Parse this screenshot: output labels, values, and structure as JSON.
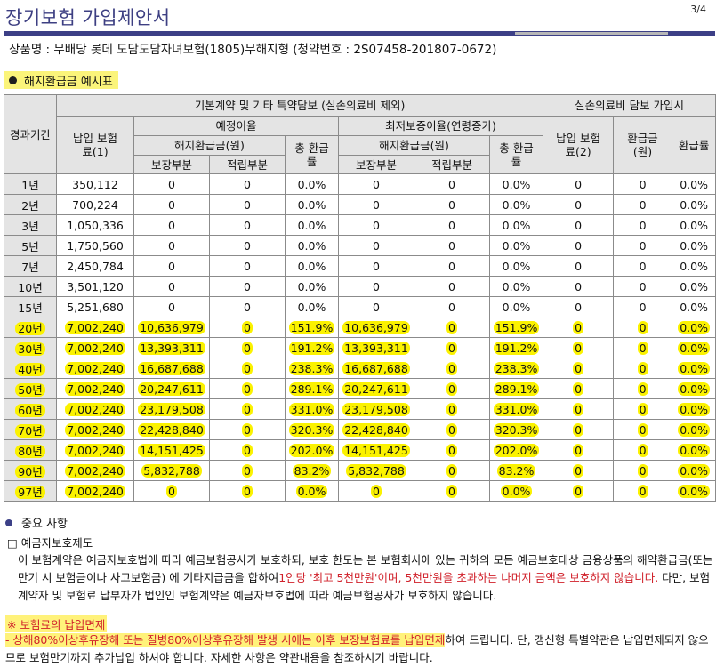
{
  "header": {
    "title": "장기보험 가입제안서",
    "page": "3/4"
  },
  "product": "상품명 : 무배당 롯데 도담도담자녀보험(1805)무해지형 (청약번호 : 2S07458-201807-0672)",
  "section_title": "해지환급금 예시표",
  "table": {
    "h_period": "경과기간",
    "h_basic": "기본계약 및 기타 특약담보 (실손의료비 제외)",
    "h_medical": "실손의료비 담보 가입시",
    "h_premium1": "납입 보험료(1)",
    "h_expected": "예정이율",
    "h_min": "최저보증이율(연령증가)",
    "h_surrender_a": "해지환급금(원)",
    "h_surrender_b": "해지환급금(원)",
    "h_total_a": "총 환급률",
    "h_total_b": "총 환급률",
    "h_protect_a": "보장부분",
    "h_save_a": "적립부분",
    "h_protect_b": "보장부분",
    "h_save_b": "적립부분",
    "h_premium2": "납입 보험료(2)",
    "h_refund": "환급금 (원)",
    "h_rate": "환급률",
    "rows": [
      [
        "1년",
        "350,112",
        "0",
        "0",
        "0.0%",
        "0",
        "0",
        "0.0%",
        "0",
        "0",
        "0.0%"
      ],
      [
        "2년",
        "700,224",
        "0",
        "0",
        "0.0%",
        "0",
        "0",
        "0.0%",
        "0",
        "0",
        "0.0%"
      ],
      [
        "3년",
        "1,050,336",
        "0",
        "0",
        "0.0%",
        "0",
        "0",
        "0.0%",
        "0",
        "0",
        "0.0%"
      ],
      [
        "5년",
        "1,750,560",
        "0",
        "0",
        "0.0%",
        "0",
        "0",
        "0.0%",
        "0",
        "0",
        "0.0%"
      ],
      [
        "7년",
        "2,450,784",
        "0",
        "0",
        "0.0%",
        "0",
        "0",
        "0.0%",
        "0",
        "0",
        "0.0%"
      ],
      [
        "10년",
        "3,501,120",
        "0",
        "0",
        "0.0%",
        "0",
        "0",
        "0.0%",
        "0",
        "0",
        "0.0%"
      ],
      [
        "15년",
        "5,251,680",
        "0",
        "0",
        "0.0%",
        "0",
        "0",
        "0.0%",
        "0",
        "0",
        "0.0%"
      ],
      [
        "20년",
        "7,002,240",
        "10,636,979",
        "0",
        "151.9%",
        "10,636,979",
        "0",
        "151.9%",
        "0",
        "0",
        "0.0%"
      ],
      [
        "30년",
        "7,002,240",
        "13,393,311",
        "0",
        "191.2%",
        "13,393,311",
        "0",
        "191.2%",
        "0",
        "0",
        "0.0%"
      ],
      [
        "40년",
        "7,002,240",
        "16,687,688",
        "0",
        "238.3%",
        "16,687,688",
        "0",
        "238.3%",
        "0",
        "0",
        "0.0%"
      ],
      [
        "50년",
        "7,002,240",
        "20,247,611",
        "0",
        "289.1%",
        "20,247,611",
        "0",
        "289.1%",
        "0",
        "0",
        "0.0%"
      ],
      [
        "60년",
        "7,002,240",
        "23,179,508",
        "0",
        "331.0%",
        "23,179,508",
        "0",
        "331.0%",
        "0",
        "0",
        "0.0%"
      ],
      [
        "70년",
        "7,002,240",
        "22,428,840",
        "0",
        "320.3%",
        "22,428,840",
        "0",
        "320.3%",
        "0",
        "0",
        "0.0%"
      ],
      [
        "80년",
        "7,002,240",
        "14,151,425",
        "0",
        "202.0%",
        "14,151,425",
        "0",
        "202.0%",
        "0",
        "0",
        "0.0%"
      ],
      [
        "90년",
        "7,002,240",
        "5,832,788",
        "0",
        "83.2%",
        "5,832,788",
        "0",
        "83.2%",
        "0",
        "0",
        "0.0%"
      ],
      [
        "97년",
        "7,002,240",
        "0",
        "0",
        "0.0%",
        "0",
        "0",
        "0.0%",
        "0",
        "0",
        "0.0%"
      ]
    ],
    "highlight_from_row": 7
  },
  "important": {
    "title": "중요 사항",
    "sub": "□ 예금자보호제도",
    "p1": "이 보험계약은 예금자보호법에 따라 예금보험공사가 보호하되, 보호 한도는 본 보험회사에 있는 귀하의 모든 예금보호대상 금융상품의 해약환급금(또는 만기 시 보험금이나 사고보험금) 에 기타지급금을 합하여",
    "p1_red": "1인당 '최고 5천만원'이며, 5천만원을 초과하는 나머지 금액은 보호하지 않습니다.",
    "p1_end": " 다만, 보험계약자 및 보험료 납부자가 법인인 보험계약은 예금자보호법에 따라 예금보험공사가 보호하지 않습니다.",
    "note_title": "※ 보험료의 납입면제",
    "note_red": "- 상해80%이상후유장해 또는 질병80%이상후유장해 발생 시에는 이후 보장보험료를 납입면제",
    "note_rest": "하여 드립니다. 단, 갱신형 특별약관은 납입면제되지 않으므로 보험만기까지 추가납입 하셔야 합니다. 자세한 사항은 약관내용을 참조하시기 바랍니다."
  }
}
